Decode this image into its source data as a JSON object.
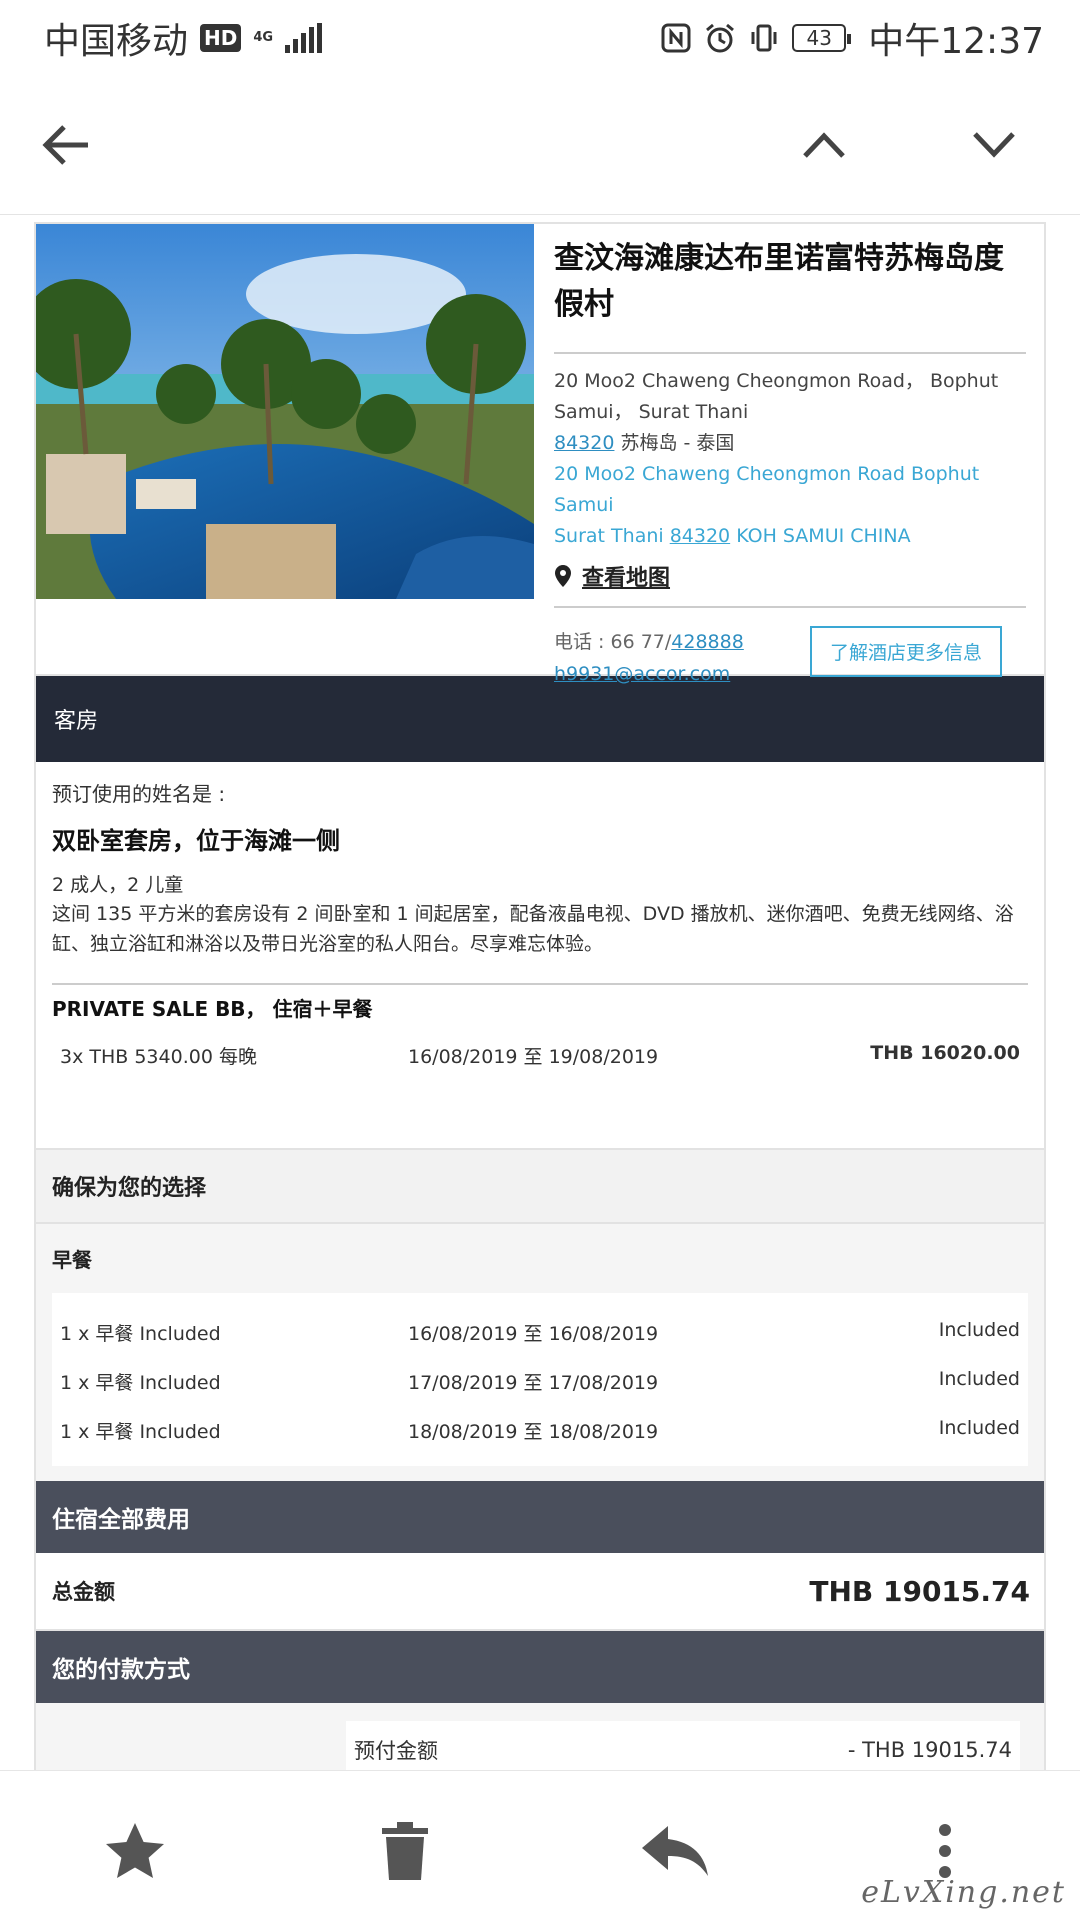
{
  "status_bar": {
    "carrier": "中国移动",
    "hd": "HD",
    "network": "4G",
    "battery": "43",
    "time": "中午12:37"
  },
  "hotel": {
    "name": "查汶海滩康达布里诺富特苏梅岛度假村",
    "address_line1": "20 Moo2 Chaweng Cheongmon Road， Bophut Samui， Surat Thani",
    "postcode": "84320",
    "address_line2_suffix": " 苏梅岛 - 泰国",
    "address_en_line1": "20 Moo2 Chaweng Cheongmon Road Bophut Samui",
    "address_en_prefix": "Surat Thani ",
    "address_en_postcode": "84320",
    "address_en_suffix": " KOH SAMUI CHINA",
    "map_link": "查看地图",
    "phone_prefix": "电话 : 66 77/",
    "phone_number": "428888",
    "email": "h9931@accor.com",
    "more_info_button": "了解酒店更多信息"
  },
  "room_section": {
    "header": "客房",
    "guest_label": "预订使用的姓名是 :",
    "room_name": "双卧室套房，位于海滩一侧",
    "occupancy": "2 成人，2 儿童",
    "description": "这间 135 平方米的套房设有 2 间卧室和 1 间起居室，配备液晶电视、DVD 播放机、迷你酒吧、免费无线网络、浴缸、独立浴缸和淋浴以及带日光浴室的私人阳台。尽享难忘体验。",
    "rate_name": "PRIVATE SALE BB， 住宿＋早餐",
    "rate_row": {
      "nights": "3x THB 5340.00 每晚",
      "dates": "16/08/2019 至 19/08/2019",
      "amount": "THB 16020.00"
    }
  },
  "selection": {
    "header": "确保为您的选择",
    "breakfast_title": "早餐",
    "rows": [
      {
        "item": "1 x 早餐 Included",
        "dates": "16/08/2019 至 16/08/2019",
        "price": "Included"
      },
      {
        "item": "1 x 早餐 Included",
        "dates": "17/08/2019 至 17/08/2019",
        "price": "Included"
      },
      {
        "item": "1 x 早餐 Included",
        "dates": "18/08/2019 至 18/08/2019",
        "price": "Included"
      }
    ]
  },
  "costs": {
    "header": "住宿全部费用",
    "total_label": "总金额",
    "total_amount": "THB 19015.74"
  },
  "payment": {
    "header": "您的付款方式",
    "prepay_label": "预付金额",
    "prepay_amount": "- THB 19015.74"
  },
  "watermark": "eLvXing.net",
  "colors": {
    "dark_header": "#242a38",
    "mid_header": "#4a4f5c",
    "accent": "#3aa7d4"
  }
}
